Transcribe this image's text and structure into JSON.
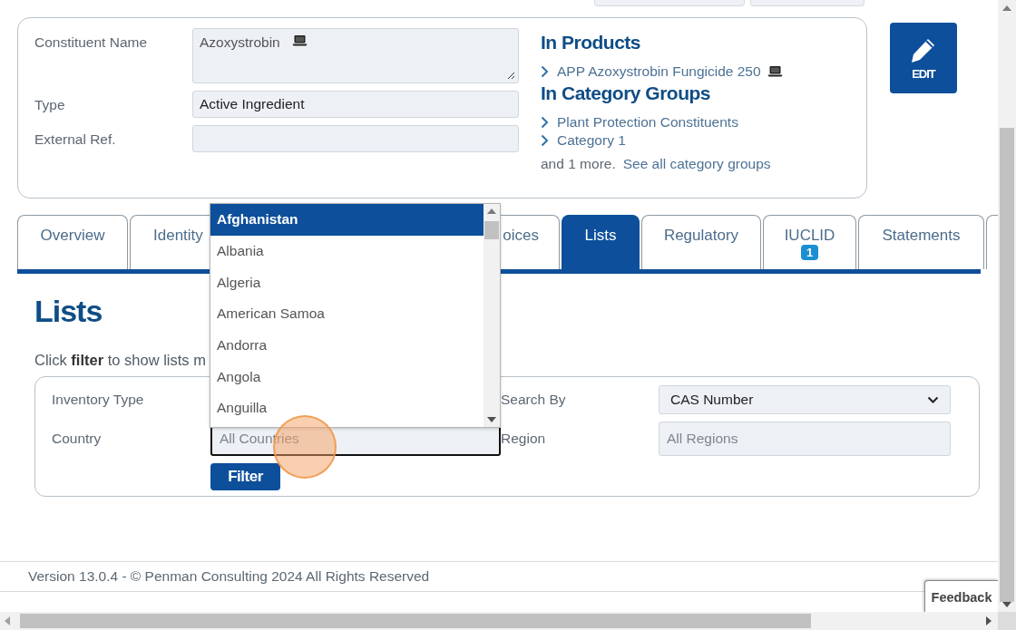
{
  "details": {
    "fields": [
      {
        "label": "Constituent Name",
        "kind": "textarea",
        "value": "Azoxystrobin",
        "device_icon": true
      },
      {
        "label": "Type",
        "kind": "input",
        "value": "Active Ingredient",
        "device_icon": false
      },
      {
        "label": "External Ref.",
        "kind": "input",
        "device_icon": false
      }
    ],
    "products": {
      "title": "In Products",
      "links": [
        {
          "label": "APP Azoxystrobin Fungicide 250",
          "device_icon": true
        }
      ]
    },
    "category_groups": {
      "title": "In Category Groups",
      "links": [
        {
          "label": "Plant Protection Constituents",
          "device_icon": false
        },
        {
          "label": "Category 1",
          "device_icon": false
        }
      ],
      "more_text": "and 1 more.",
      "more_link": "See all category groups"
    }
  },
  "edit_button": {
    "label": "EDIT"
  },
  "tabs": [
    {
      "label": "Overview",
      "selected": false
    },
    {
      "label": "Identity",
      "selected": false
    },
    {
      "label": "oices",
      "selected": false
    },
    {
      "label": "Lists",
      "selected": true
    },
    {
      "label": "Regulatory",
      "selected": false
    },
    {
      "label": "IUCLID",
      "selected": false,
      "badge": "1"
    },
    {
      "label": "Statements",
      "selected": false
    },
    {
      "selected": false
    }
  ],
  "section": {
    "title": "Lists",
    "intro": "Click **filter** to show lists m"
  },
  "filter": {
    "left": [
      {
        "label": "Inventory Type"
      },
      {
        "label": "Country",
        "placeholder": "All Countries",
        "focused": true
      }
    ],
    "right": [
      {
        "label": "Search By",
        "kind": "select",
        "value": "CAS Number"
      },
      {
        "label": "Region",
        "kind": "input",
        "placeholder": "All Regions"
      }
    ],
    "button": "Filter"
  },
  "country_dropdown": {
    "options": [
      {
        "label": "Afghanistan",
        "selected": true
      },
      {
        "label": "Albania",
        "selected": false
      },
      {
        "label": "Algeria",
        "selected": false
      },
      {
        "label": "American Samoa",
        "selected": false
      },
      {
        "label": "Andorra",
        "selected": false
      },
      {
        "label": "Angola",
        "selected": false
      },
      {
        "label": "Anguilla",
        "selected": false
      }
    ]
  },
  "footer": {
    "text": "Version 13.0.4 - © Penman Consulting 2024 All Rights Reserved"
  },
  "feedback_button": "Feedback"
}
